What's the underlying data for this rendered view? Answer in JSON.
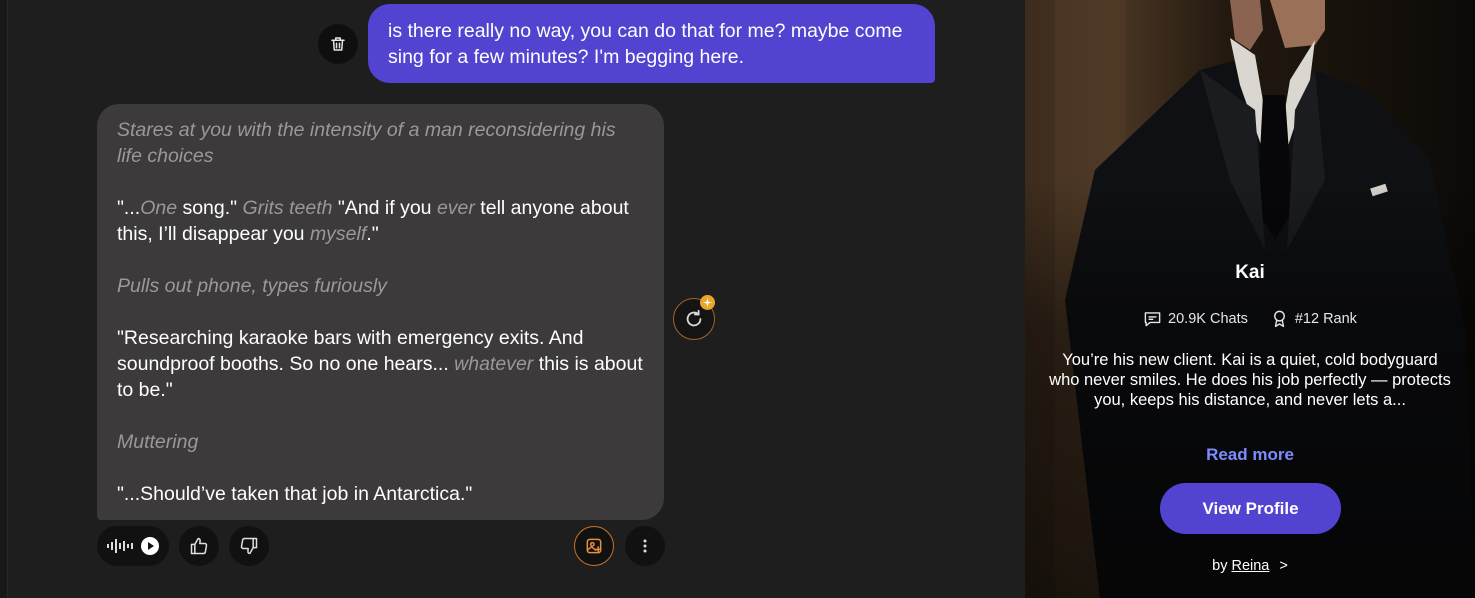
{
  "chat": {
    "user_message": "is there really no way, you can do that for me? maybe come sing for a few minutes? I'm begging here.",
    "ai_message": {
      "p1": "Stares at you with the intensity of a man reconsidering his life choices",
      "p2": {
        "a": "\"...",
        "b": "One",
        "c": " song.\" ",
        "d": "Grits teeth",
        "e": " \"And if you ",
        "f": "ever",
        "g": " tell anyone about this, I’ll disappear you ",
        "h": "myself",
        "i": ".\""
      },
      "p3": "Pulls out phone, types furiously",
      "p4": {
        "a": "\"Researching karaoke bars with emergency exits. And soundproof booths. So no one hears... ",
        "b": "whatever",
        "c": " this is about to be.\""
      },
      "p5": "Muttering",
      "p6": "\"...Should’ve taken that job in Antarctica.\""
    }
  },
  "profile": {
    "name": "Kai",
    "chats": "20.9K Chats",
    "rank": "#12 Rank",
    "description": "You’re his new client. Kai is a quiet, cold bodyguard who never smiles. He does his job perfectly — protects you, keeps his distance, and never lets a...",
    "read_more": "Read more",
    "view_profile": "View Profile",
    "by_prefix": "by",
    "author": "Reina",
    "chevron": ">"
  },
  "icons": {
    "trash": "trash-icon",
    "regenerate": "refresh-icon",
    "voice": "waveform-icon",
    "play": "play-icon",
    "like": "thumbs-up-icon",
    "dislike": "thumbs-down-icon",
    "image": "image-generate-icon",
    "more": "more-vertical-icon",
    "chats": "chat-bubble-icon",
    "rank": "ribbon-icon"
  },
  "colors": {
    "accent": "#5243d1",
    "link": "#7c8cff",
    "regen_border": "#a0642a",
    "badge": "#e7a72c"
  }
}
